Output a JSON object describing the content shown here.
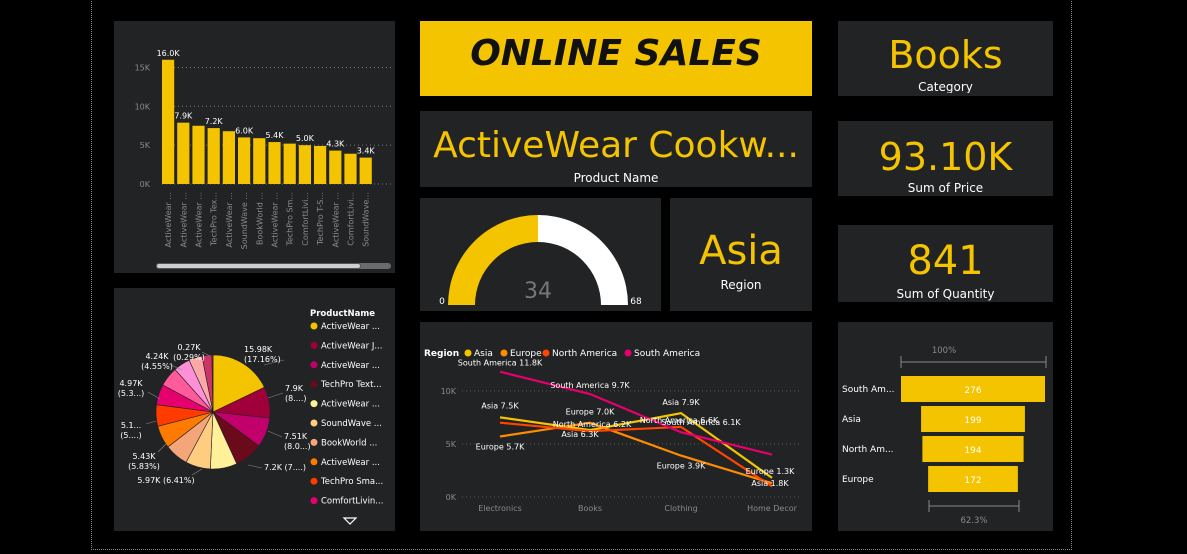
{
  "title": "ONLINE SALES",
  "cards": {
    "category": {
      "value": "Books",
      "label": "Category"
    },
    "product": {
      "value": "ActiveWear Cookw...",
      "label": "Product Name"
    },
    "price": {
      "value": "93.10K",
      "label": "Sum of Price"
    },
    "region": {
      "value": "Asia",
      "label": "Region"
    },
    "quantity": {
      "value": "841",
      "label": "Sum of Quantity"
    }
  },
  "gauge": {
    "value": 34,
    "min": 0,
    "max": 68,
    "value_label": "34",
    "min_label": "0",
    "max_label": "68"
  },
  "colors": {
    "accent": "#f5c400",
    "panel": "#222324",
    "background": "#000000"
  },
  "chart_data": [
    {
      "type": "bar",
      "categories": [
        "ActiveWear ...",
        "ActiveWear ...",
        "ActiveWear ...",
        "TechPro Tex...",
        "ActiveWear ...",
        "SoundWave ...",
        "BookWorld ...",
        "ActiveWear ...",
        "TechPro Sm...",
        "ComfortLivi...",
        "TechPro T-S...",
        "ActiveWear ...",
        "ComfortLivi...",
        "SoundWave..."
      ],
      "values": [
        16.0,
        7.9,
        7.5,
        7.2,
        6.8,
        6.0,
        5.9,
        5.4,
        5.2,
        5.0,
        4.9,
        4.3,
        3.9,
        3.4
      ],
      "data_labels": [
        {
          "index": 0,
          "text": "16.0K"
        },
        {
          "index": 1,
          "text": "7.9K"
        },
        {
          "index": 3,
          "text": "7.2K"
        },
        {
          "index": 5,
          "text": "6.0K"
        },
        {
          "index": 7,
          "text": "5.4K"
        },
        {
          "index": 9,
          "text": "5.0K"
        },
        {
          "index": 11,
          "text": "4.3K"
        },
        {
          "index": 13,
          "text": "3.4K"
        }
      ],
      "unit": "K",
      "yticks": [
        0,
        5,
        10,
        15
      ],
      "ytick_labels": [
        "0K",
        "5K",
        "10K",
        "15K"
      ],
      "ylim": [
        0,
        17
      ],
      "grid": true
    },
    {
      "type": "pie",
      "legend_title": "ProductName",
      "legend": [
        "ActiveWear ...",
        "ActiveWear J...",
        "ActiveWear ...",
        "TechPro Text...",
        "ActiveWear ...",
        "SoundWave ...",
        "BookWorld ...",
        "ActiveWear ...",
        "TechPro Sma...",
        "ComfortLivin..."
      ],
      "slices": [
        {
          "value": 17.16,
          "color": "#f5c400"
        },
        {
          "value": 8.48,
          "color": "#a0003a"
        },
        {
          "value": 8.06,
          "color": "#c2006b"
        },
        {
          "value": 7.73,
          "color": "#6b0a1a"
        },
        {
          "value": 7.28,
          "color": "#fff199"
        },
        {
          "value": 6.8,
          "color": "#ffcc80"
        },
        {
          "value": 6.41,
          "color": "#f5a57a"
        },
        {
          "value": 6.2,
          "color": "#ff7a00"
        },
        {
          "value": 5.83,
          "color": "#ff3b00"
        },
        {
          "value": 5.6,
          "color": "#e6006e"
        },
        {
          "value": 5.3,
          "color": "#ff5a9a"
        },
        {
          "value": 4.55,
          "color": "#ff8fd6"
        },
        {
          "value": 3.6,
          "color": "#ffa8a8"
        },
        {
          "value": 2.7,
          "color": "#cc3366"
        },
        {
          "value": 0.29,
          "color": "#b3004d"
        }
      ],
      "labels": [
        {
          "line1": "15.98K",
          "line2": "(17.16%)"
        },
        {
          "line1": "7.9K",
          "line2": "(8....)"
        },
        {
          "line1": "7.51K",
          "line2": "(8.0...)"
        },
        {
          "line1": "7.2K (7....)",
          "line2": ""
        },
        {
          "line1": "5.97K (6.41%)",
          "line2": ""
        },
        {
          "line1": "5.43K",
          "line2": "(5.83%)"
        },
        {
          "line1": "5.1...",
          "line2": "(5....)"
        },
        {
          "line1": "4.97K",
          "line2": "(5.3...)"
        },
        {
          "line1": "4.24K",
          "line2": "(4.55%)"
        },
        {
          "line1": "0.27K",
          "line2": "(0.29%)"
        }
      ]
    },
    {
      "type": "line",
      "legend_title": "Region",
      "categories": [
        "Electronics",
        "Books",
        "Clothing",
        "Home Decor"
      ],
      "yticks": [
        0,
        5,
        10
      ],
      "ytick_labels": [
        "0K",
        "5K",
        "10K"
      ],
      "ylim": [
        0,
        13
      ],
      "unit": "K",
      "series": [
        {
          "name": "Asia",
          "color": "#f5c400",
          "values": [
            7.5,
            6.3,
            7.9,
            1.8
          ],
          "labels": [
            "Asia 7.5K",
            "Asia 6.3K",
            "Asia 7.9K",
            "Asia 1.8K"
          ]
        },
        {
          "name": "Europe",
          "color": "#ff8c00",
          "values": [
            5.7,
            7.0,
            3.9,
            1.3
          ],
          "labels": [
            "Europe 5.7K",
            "Europe 7.0K",
            "Europe 3.9K",
            "Europe 1.3K"
          ]
        },
        {
          "name": "North America",
          "color": "#ff4500",
          "values": [
            7.0,
            6.2,
            6.6,
            1.0
          ],
          "labels": [
            "",
            "North America 6.2K",
            "North America 6.6K",
            ""
          ]
        },
        {
          "name": "South America",
          "color": "#e6006e",
          "values": [
            11.8,
            9.7,
            6.1,
            4.0
          ],
          "labels": [
            "South America 11.8K",
            "South America 9.7K",
            "South America 6.1K",
            ""
          ]
        }
      ]
    },
    {
      "type": "bar",
      "orientation": "funnel",
      "categories": [
        "South Am...",
        "Asia",
        "North Am...",
        "Europe"
      ],
      "values": [
        276,
        199,
        194,
        172
      ],
      "top_label": "100%",
      "bottom_label": "62.3%"
    }
  ]
}
